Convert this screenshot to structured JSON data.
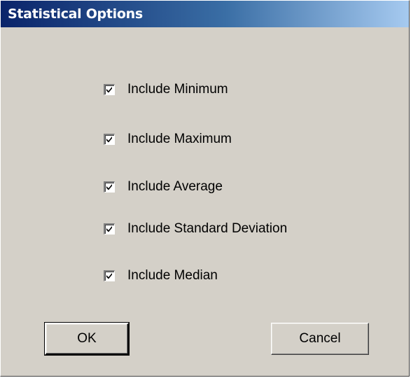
{
  "window": {
    "title": "Statistical Options"
  },
  "options": [
    {
      "label": "Include Minimum",
      "checked": true
    },
    {
      "label": "Include Maximum",
      "checked": true
    },
    {
      "label": "Include Average",
      "checked": true
    },
    {
      "label": "Include Standard Deviation",
      "checked": true
    },
    {
      "label": "Include Median",
      "checked": true
    }
  ],
  "buttons": {
    "ok_label": "OK",
    "cancel_label": "Cancel"
  },
  "colors": {
    "titlebar_start": "#0a246a",
    "titlebar_end": "#a6caf0",
    "dialog_bg": "#d4d0c8"
  }
}
